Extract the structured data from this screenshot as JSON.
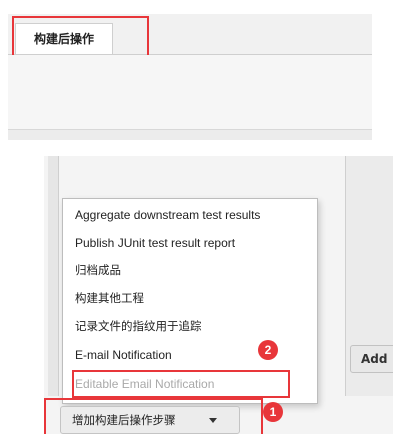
{
  "tabs": [
    {
      "label": "构建后操作",
      "active": true
    }
  ],
  "dropdown": {
    "items": [
      {
        "label": "Aggregate downstream test results",
        "enabled": true
      },
      {
        "label": "Publish JUnit test result report",
        "enabled": true
      },
      {
        "label": "归档成品",
        "enabled": true
      },
      {
        "label": "构建其他工程",
        "enabled": true
      },
      {
        "label": "记录文件的指纹用于追踪",
        "enabled": true
      },
      {
        "label": "E-mail Notification",
        "enabled": true
      },
      {
        "label": "Editable Email Notification",
        "enabled": false
      }
    ]
  },
  "buttons": {
    "add_post_build_step": "增加构建后操作步骤",
    "add_partial": "Add"
  },
  "annotations": {
    "badge_1": "1",
    "badge_2": "2"
  },
  "colors": {
    "highlight": "#e8363a",
    "disabled_text": "#a9a9a9"
  },
  "icons": {
    "dropdown_caret": "chevron-down-icon"
  }
}
